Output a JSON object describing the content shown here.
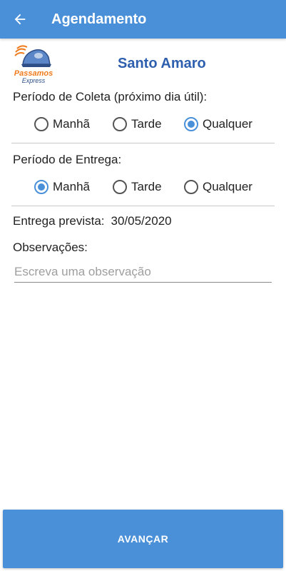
{
  "appbar": {
    "title": "Agendamento",
    "back_icon": "arrow-left-icon"
  },
  "header": {
    "logo_text_1": "Passamos",
    "logo_text_2": "Express",
    "store_name": "Santo Amaro"
  },
  "coleta": {
    "label": "Período de Coleta (próximo dia útil):",
    "options": [
      "Manhã",
      "Tarde",
      "Qualquer"
    ],
    "selected": "Qualquer"
  },
  "entrega": {
    "label": "Período de Entrega:",
    "options": [
      "Manhã",
      "Tarde",
      "Qualquer"
    ],
    "selected": "Manhã"
  },
  "prevista": {
    "label": "Entrega prevista:",
    "value": "30/05/2020"
  },
  "observacoes": {
    "label": "Observações:",
    "placeholder": "Escreva uma observação"
  },
  "footer": {
    "button_label": "AVANÇAR"
  },
  "colors": {
    "primary": "#4a90d9",
    "store_name": "#2e5fae",
    "logo_orange": "#f07b1d"
  }
}
